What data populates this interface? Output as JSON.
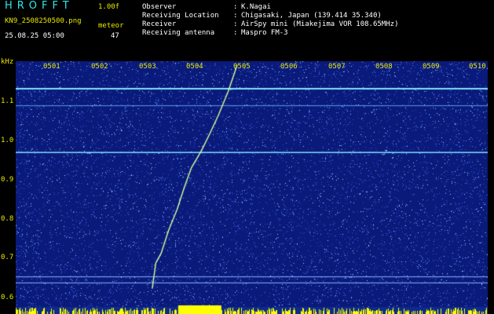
{
  "header": {
    "app_title": "HROFFT",
    "version": "1.00f",
    "filename": "KN9_2508250500.png",
    "meteor_label": "meteor",
    "datetime": "25.08.25 05:00",
    "count": "47"
  },
  "info": {
    "observer_key": "Observer",
    "observer_val": "K.Nagai",
    "location_key": "Receiving Location",
    "location_val": "Chigasaki, Japan (139.414 35.340)",
    "receiver_key": "Receiver",
    "receiver_val": "AirSpy mini (Miakejima VOR 108.65MHz)",
    "antenna_key": "Receiving antenna",
    "antenna_val": "Maspro FM-3",
    "separator": ":"
  },
  "axis": {
    "y_unit": "kHz",
    "y_ticks": [
      "1.1",
      "1.0",
      "0.9",
      "0.8",
      "0.7",
      "0.6"
    ],
    "x_ticks": [
      "0501",
      "0502",
      "0503",
      "0504",
      "0505",
      "0506",
      "0507",
      "0508",
      "0509",
      "0510"
    ]
  },
  "colors": {
    "background": "#0a1a7a",
    "noise": "#9fd4ff",
    "trace": "#d8ff9a",
    "carrier": "#7fe0ff",
    "label": "#e9e900",
    "title": "#2ee8e8",
    "bottom_bar": "#ffff00"
  }
}
